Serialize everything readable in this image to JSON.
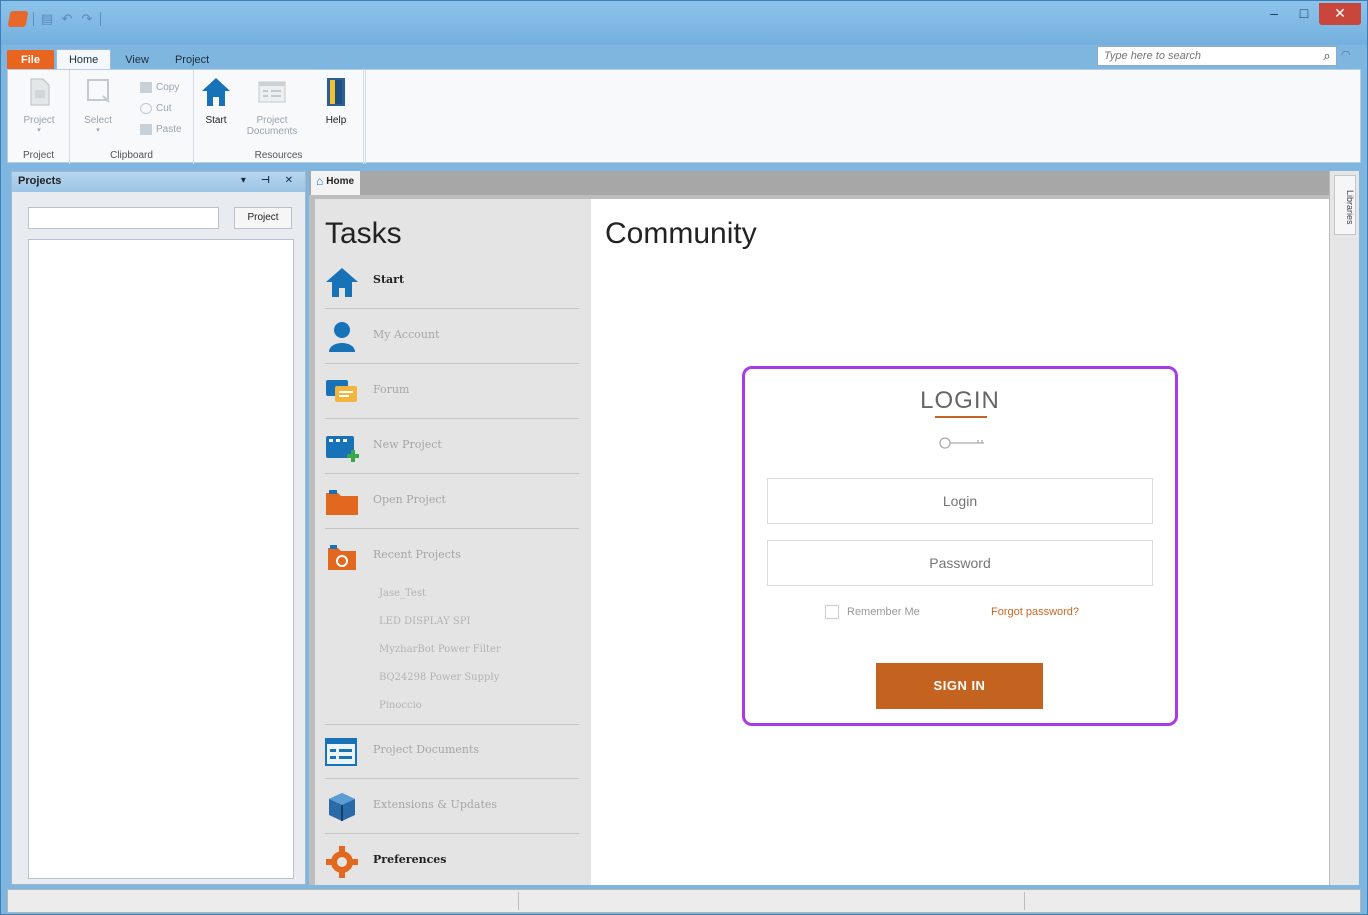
{
  "titlebar": {
    "win_controls": {
      "minimize": "–",
      "maximize": "□",
      "close": "✕"
    }
  },
  "ribbon_tabs": [
    "File",
    "Home",
    "View",
    "Project"
  ],
  "search": {
    "placeholder": "Type here to search"
  },
  "ribbon": {
    "groups": {
      "project": "Project",
      "clipboard": "Clipboard",
      "resources": "Resources"
    },
    "buttons": {
      "project": "Project",
      "select": "Select",
      "copy": "Copy",
      "cut": "Cut",
      "paste": "Paste",
      "start": "Start",
      "project_documents_line1": "Project",
      "project_documents_line2": "Documents",
      "help": "Help"
    }
  },
  "projects_panel": {
    "title": "Projects",
    "controls": "▾ ⊣ ✕",
    "filter_button": "Project"
  },
  "doc_tab": {
    "label": "Home"
  },
  "right_strip": {
    "tab": "Libraries"
  },
  "tasks": {
    "title": "Tasks",
    "items": [
      {
        "label": "Start",
        "icon": "home-icon"
      },
      {
        "label": "My Account",
        "icon": "user-icon"
      },
      {
        "label": "Forum",
        "icon": "forum-icon"
      },
      {
        "label": "New Project",
        "icon": "new-project-icon"
      },
      {
        "label": "Open Project",
        "icon": "folder-open-icon"
      },
      {
        "label": "Recent Projects",
        "icon": "recent-projects-icon"
      },
      {
        "label": "Project Documents",
        "icon": "documents-icon"
      },
      {
        "label": "Extensions & Updates",
        "icon": "extensions-icon"
      },
      {
        "label": "Preferences",
        "icon": "gear-icon"
      }
    ],
    "recent": [
      "Jase_Test",
      "LED DISPLAY SPI",
      "MyzharBot Power Filter",
      "BQ24298 Power Supply",
      "Pinoccio"
    ]
  },
  "community": {
    "title": "Community",
    "login": {
      "heading": "LOGIN",
      "login_placeholder": "Login",
      "password_placeholder": "Password",
      "remember_me": "Remember Me",
      "forgot_password": "Forgot password?",
      "sign_in": "SIGN IN"
    }
  },
  "colors": {
    "accent": "#c4621f",
    "login_border": "#a93ae8",
    "home_icon_blue": "#1872b8",
    "file_tab": "#e8641f"
  }
}
